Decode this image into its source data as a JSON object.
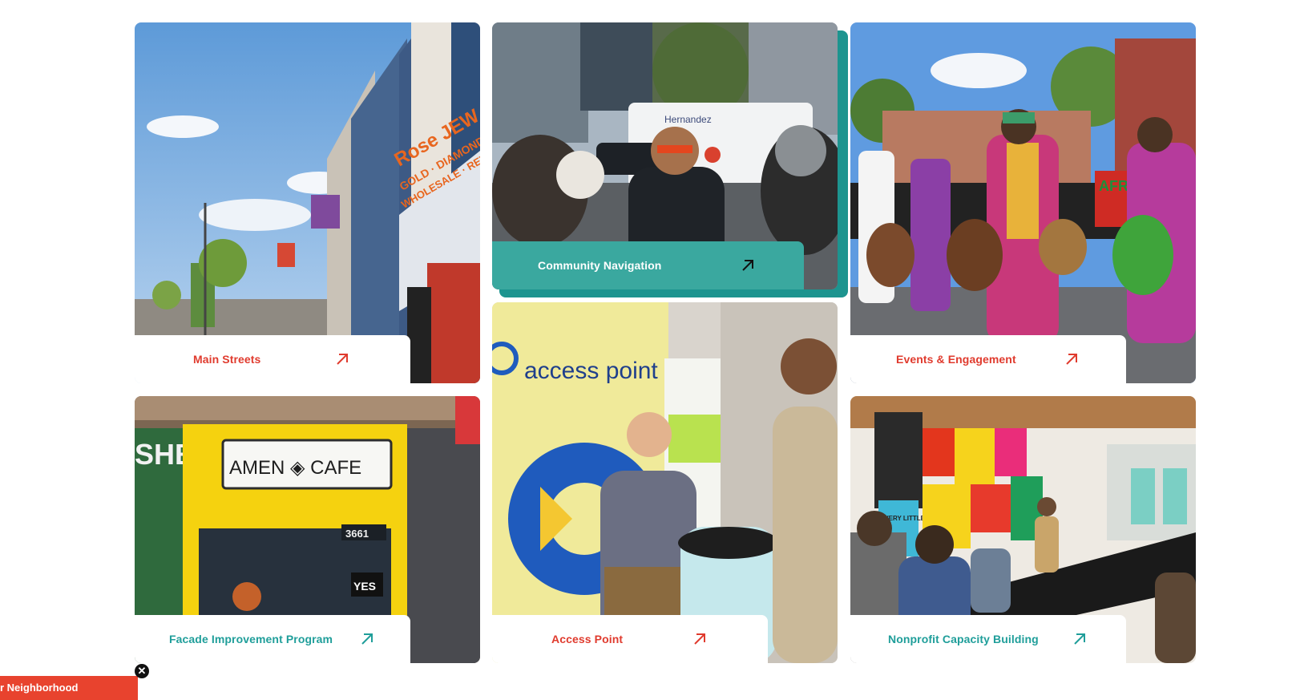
{
  "cards": {
    "main_streets": {
      "label": "Main Streets"
    },
    "community_navigation": {
      "label": "Community Navigation"
    },
    "events_engagement": {
      "label": "Events & Engagement"
    },
    "facade_improvement": {
      "label": "Facade Improvement Program"
    },
    "access_point": {
      "label": "Access Point"
    },
    "nonprofit_capacity": {
      "label": "Nonprofit Capacity Building"
    }
  },
  "photo_text": {
    "rose_sign": "Rose JEW",
    "rose_sub": "GOLD · DIAMONDS",
    "rose_sub2": "WHOLESALE · RETA",
    "amen_cafe": "AMEN ◈ CAFE",
    "shed_bills": "SHED BILLS",
    "store_number": "3661",
    "yes_sign": "YES",
    "access_point_logo": "access point",
    "hernandez_van": "Hernandez",
    "afro_sign": "AFR ON",
    "every_sign": "EVERY LITTLE BIT HELPS"
  },
  "banner": {
    "text": "r Neighborhood"
  },
  "colors": {
    "red": "#e03b2e",
    "teal": "#1f9e9a",
    "nav_bg": "#3aa89f",
    "banner": "#e8432e"
  },
  "icons": {
    "arrow": "arrow-up-right-icon",
    "close": "close-icon"
  }
}
